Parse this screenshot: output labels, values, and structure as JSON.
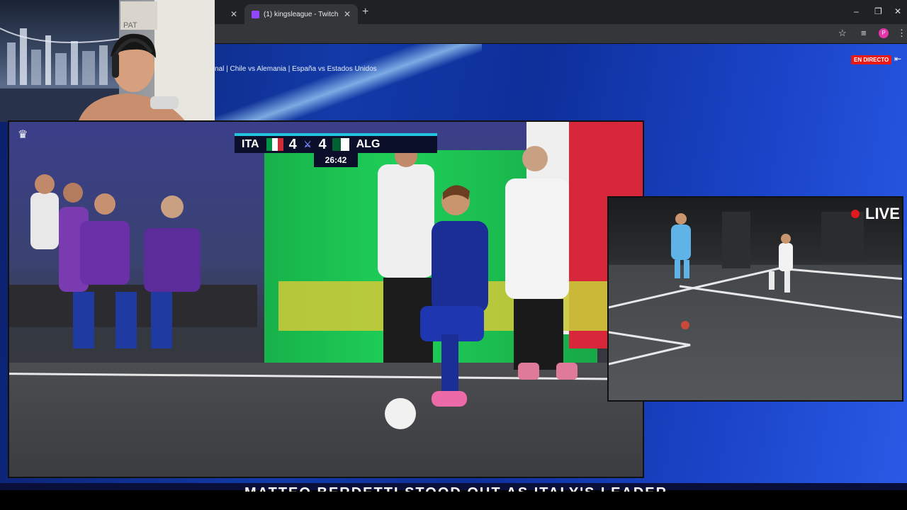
{
  "browser": {
    "tabs": [
      {
        "title": "",
        "active": false
      },
      {
        "title": "(1) kingsleague - Twitch",
        "active": true
      }
    ],
    "new_tab_symbol": "+",
    "window_controls": [
      "–",
      "❐",
      "✕"
    ]
  },
  "page": {
    "ticker_text": "nal | Chile vs Alemania | España vs Estados Unidos",
    "live_badge": "EN DIRECTO",
    "bottom_caption": "MATTEO BERDETTI STOOD OUT AS ITALY'S LEADER"
  },
  "webcam": {
    "poster_text": "PAT"
  },
  "scoreboard": {
    "home_team": "ITA",
    "home_score": "4",
    "away_score": "4",
    "away_team": "ALG",
    "clock": "26:42"
  },
  "pip": {
    "live_label": "LIVE"
  },
  "colors": {
    "live_red": "#e91916",
    "score_accent": "#22c4e0",
    "page_blue": "#123aa8"
  }
}
